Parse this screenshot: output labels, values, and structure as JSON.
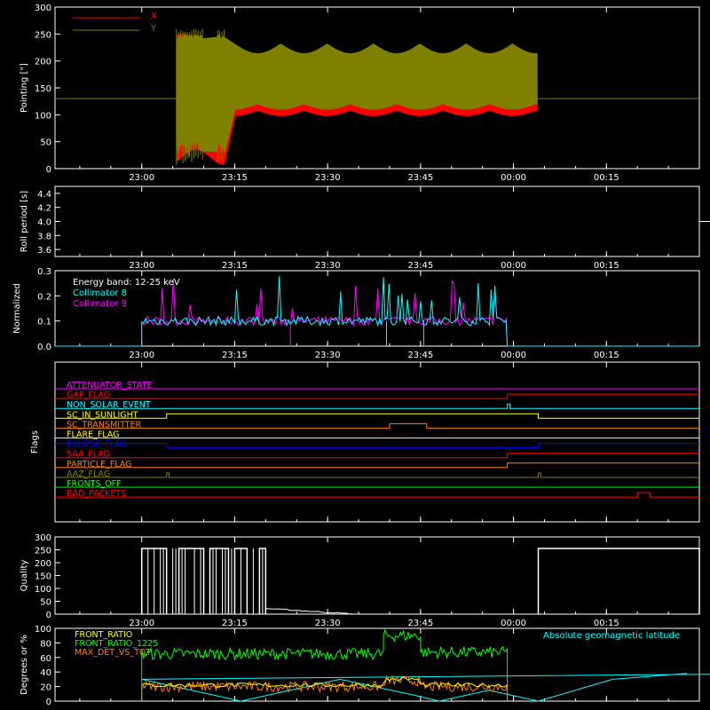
{
  "time_ticks": [
    "23:00",
    "23:15",
    "23:30",
    "23:45",
    "00:00",
    "00:15"
  ],
  "chart_data": [
    {
      "type": "line",
      "ylabel": "Pointing [\"]",
      "ylim": [
        0,
        300
      ],
      "yticks": [
        0,
        50,
        100,
        150,
        200,
        250,
        300
      ],
      "legend_position": "top-left",
      "series": [
        {
          "name": "X",
          "color": "#ff0000",
          "envelope": {
            "start": "23:06",
            "end": "00:04",
            "upper": 192,
            "lower": 105
          }
        },
        {
          "name": "Y",
          "color": "#808000",
          "envelope": {
            "start": "23:06",
            "end": "00:04",
            "upper": 253,
            "lower": 45
          }
        }
      ],
      "reference_line": {
        "value": 130,
        "color": "#808000"
      }
    },
    {
      "type": "line",
      "ylabel": "Roll period [s]",
      "ylim": [
        3.5,
        4.5
      ],
      "yticks": [
        3.6,
        3.8,
        4.0,
        4.2,
        4.4
      ],
      "series": [
        {
          "value": 4.0,
          "color": "#ffffff",
          "start": "22:46",
          "end": "00:30"
        }
      ]
    },
    {
      "type": "line",
      "ylabel": "Normalized modulation",
      "ylim": [
        0,
        0.3
      ],
      "yticks": [
        0.0,
        0.1,
        0.2,
        0.3
      ],
      "annotation": "Energy band: 12-25 keV",
      "series": [
        {
          "name": "Collimator 8",
          "color": "#00ffff",
          "typical": 0.1,
          "start": "23:00",
          "end": "23:59"
        },
        {
          "name": "Collimator 9",
          "color": "#ff00ff",
          "typical": 0.1,
          "start": "23:00",
          "end": "23:59"
        }
      ]
    },
    {
      "type": "line",
      "ylabel": "Flags",
      "series": [
        {
          "name": "ATTENUATOR_STATE",
          "color": "#ff00ff",
          "changes": []
        },
        {
          "name": "GAP_FLAG",
          "color": "#ff0000",
          "changes": [
            "23:59"
          ]
        },
        {
          "name": "NON_SOLAR_EVENT",
          "color": "#00ffff",
          "changes": [
            "23:59",
            "23:59"
          ]
        },
        {
          "name": "SC_IN_SUNLIGHT",
          "color": "#ffff00",
          "changes": [
            "23:04",
            "00:04"
          ]
        },
        {
          "name": "SC_TRANSMITTER",
          "color": "#ff8000",
          "changes": [
            "23:40",
            "23:46"
          ]
        },
        {
          "name": "FLARE_FLAG",
          "color": "#ffff00",
          "changes": []
        },
        {
          "name": "ECLIPSE_FLAG",
          "color": "#0000ff",
          "changes": [
            "23:04",
            "00:04"
          ]
        },
        {
          "name": "SAA_FLAG",
          "color": "#ff0000",
          "changes": [
            "23:59"
          ]
        },
        {
          "name": "PARTICLE_FLAG",
          "color": "#ff8000",
          "changes": [
            "23:59"
          ]
        },
        {
          "name": "AAZ_FLAG",
          "color": "#808000",
          "changes": [
            "23:04",
            "23:04",
            "00:04",
            "00:04"
          ]
        },
        {
          "name": "FRONTS_OFF",
          "color": "#00ff00",
          "changes": []
        },
        {
          "name": "BAD_PACKETS",
          "color": "#ff0000",
          "changes": [
            "00:20",
            "00:22"
          ]
        }
      ]
    },
    {
      "type": "bar",
      "ylabel": "Quality",
      "ylim": [
        0,
        300
      ],
      "yticks": [
        0,
        50,
        100,
        150,
        200,
        250,
        300
      ],
      "series": [
        {
          "color": "#ffffff",
          "high_value": 255,
          "high_intervals": [
            [
              "23:00",
              "23:04"
            ],
            [
              "23:06",
              "23:10"
            ],
            [
              "23:11",
              "23:14"
            ],
            [
              "23:15",
              "23:17"
            ],
            [
              "23:19",
              "23:20"
            ],
            [
              "00:04",
              "00:30"
            ]
          ]
        }
      ]
    },
    {
      "type": "line",
      "ylabel": "Degrees or %",
      "ylim": [
        0,
        100
      ],
      "yticks": [
        0,
        20,
        40,
        60,
        80,
        100
      ],
      "series": [
        {
          "name": "FRONT_RATIO",
          "color": "#ffff00",
          "typical": 22
        },
        {
          "name": "FRONT_RATIO_1225",
          "color": "#00ff00",
          "segments": [
            [
              "23:00",
              "23:39",
              65
            ],
            [
              "23:39",
              "23:45",
              90
            ],
            [
              "23:45",
              "23:59",
              67
            ]
          ]
        },
        {
          "name": "MAX_DET_VS_TOT",
          "color": "#ff8000",
          "typical": 20
        },
        {
          "name": "Absolute geomagnetic latitude",
          "color": "#00ffff",
          "points": [
            [
              "22:46",
              38
            ],
            [
              "23:00",
              30
            ],
            [
              "23:16",
              0
            ],
            [
              "23:32",
              30
            ],
            [
              "23:44",
              8
            ],
            [
              "23:48",
              0
            ],
            [
              "23:56",
              15
            ],
            [
              "00:04",
              0
            ],
            [
              "00:16",
              30
            ],
            [
              "00:28",
              38
            ]
          ]
        }
      ]
    }
  ]
}
